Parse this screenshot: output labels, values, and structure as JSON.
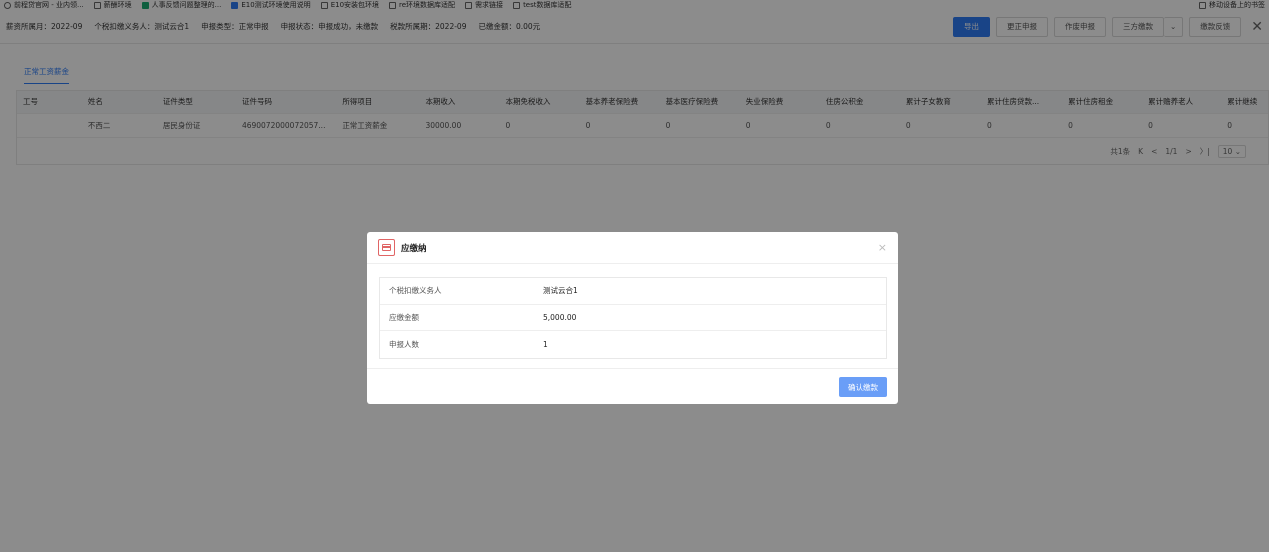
{
  "bookmarks": {
    "items": [
      {
        "label": "前程贷官网 - 业内领...",
        "icon": "globe-icon"
      },
      {
        "label": "薪酬环境",
        "icon": "folder-icon"
      },
      {
        "label": "人事反馈问题整理的...",
        "icon": "green-app-icon"
      },
      {
        "label": "E10测试环境使用说明",
        "icon": "blue-doc-icon"
      },
      {
        "label": "E10安装包环境",
        "icon": "folder-icon"
      },
      {
        "label": "re环境数据库适配",
        "icon": "folder-icon"
      },
      {
        "label": "需求链接",
        "icon": "folder-icon"
      },
      {
        "label": "test数据库适配",
        "icon": "folder-icon"
      }
    ],
    "right": "移动设备上的书签"
  },
  "info": {
    "month": "薪资所属月：2022-09",
    "agent": "个税扣缴义务人：测试云合1",
    "type": "申报类型：正常申报",
    "status": "申报状态：申报成功，未缴款",
    "period": "税款所属期：2022-09",
    "paid": "已缴金额：0.00元"
  },
  "actions": {
    "export": "导出",
    "correct": "更正申报",
    "void": "作废申报",
    "third_party": "三方缴款",
    "feedback": "缴款反馈"
  },
  "tab": "正常工资薪金",
  "table": {
    "headers": [
      "工号",
      "姓名",
      "证件类型",
      "证件号码",
      "所得项目",
      "本期收入",
      "本期免税收入",
      "基本养老保险费",
      "基本医疗保险费",
      "失业保险费",
      "住房公积金",
      "累计子女教育",
      "累计住房贷款...",
      "累计住房租金",
      "累计赡养老人",
      "累计继续"
    ],
    "rows": [
      [
        "",
        "不西二",
        "居民身份证",
        "4690072000072057...",
        "正常工资薪金",
        "30000.00",
        "0",
        "0",
        "0",
        "0",
        "0",
        "0",
        "0",
        "0",
        "0",
        "0"
      ]
    ]
  },
  "pager": {
    "total": "共1条",
    "first": "K",
    "prev": "<",
    "page": "1/1",
    "next": ">",
    "last": "〉|",
    "size": "10"
  },
  "modal": {
    "title": "应缴纳",
    "close": "×",
    "rows": [
      {
        "label": "个税扣缴义务人",
        "value": "测试云合1"
      },
      {
        "label": "应缴金额",
        "value": "5,000.00"
      },
      {
        "label": "申报人数",
        "value": "1"
      }
    ],
    "confirm": "确认缴款"
  }
}
